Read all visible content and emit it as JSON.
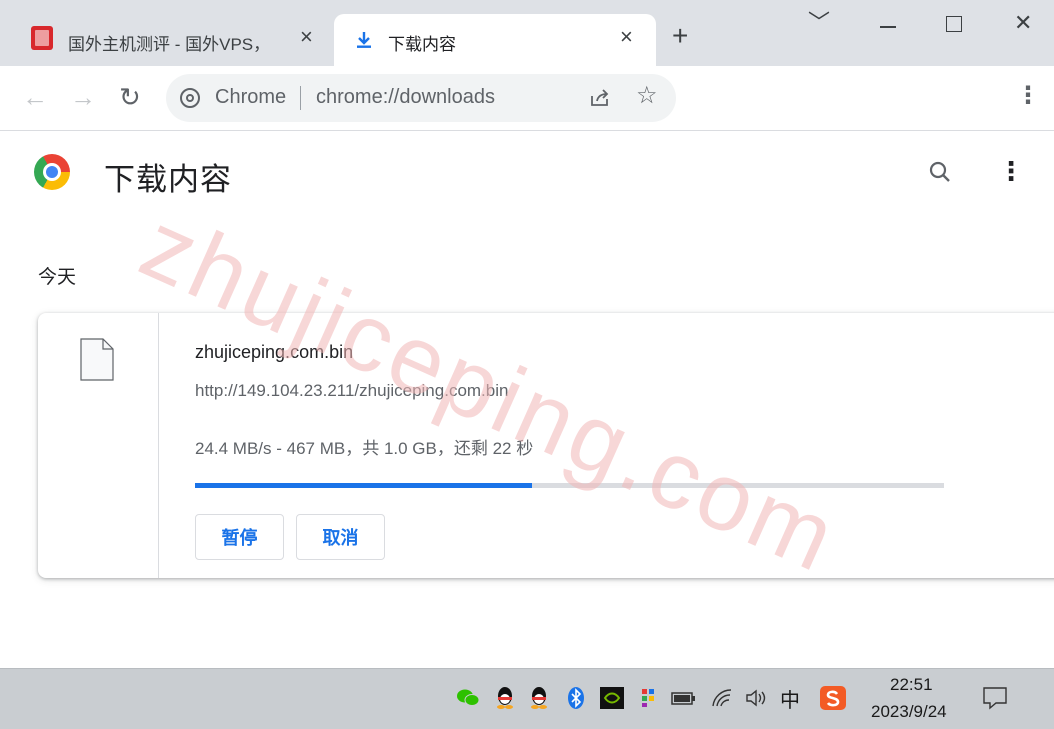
{
  "tabs": [
    {
      "title": "国外主机测评 - 国外VPS，",
      "close": "×"
    },
    {
      "title": "下载内容",
      "close": "×"
    }
  ],
  "new_tab": "+",
  "window_controls": {
    "minimize": "﹀",
    "maximize": "☐",
    "close": "✕"
  },
  "omnibox": {
    "label": "Chrome",
    "url": "chrome://downloads"
  },
  "page": {
    "title": "下载内容",
    "section_date": "今天"
  },
  "download": {
    "file_name": "zhujiceping.com.bin",
    "url": "http://149.104.23.211/zhujiceping.com.bin",
    "status": "24.4 MB/s - 467 MB，共 1.0 GB，还剩 22 秒",
    "progress_fraction": 0.45,
    "pause_label": "暂停",
    "cancel_label": "取消"
  },
  "watermark": "zhujiceping.com",
  "taskbar": {
    "ime": "中",
    "time": "22:51",
    "date": "2023/9/24"
  },
  "colors": {
    "accent": "#1a73e8",
    "tabbar": "#dee1e6",
    "taskbar": "#c9cdd1"
  }
}
